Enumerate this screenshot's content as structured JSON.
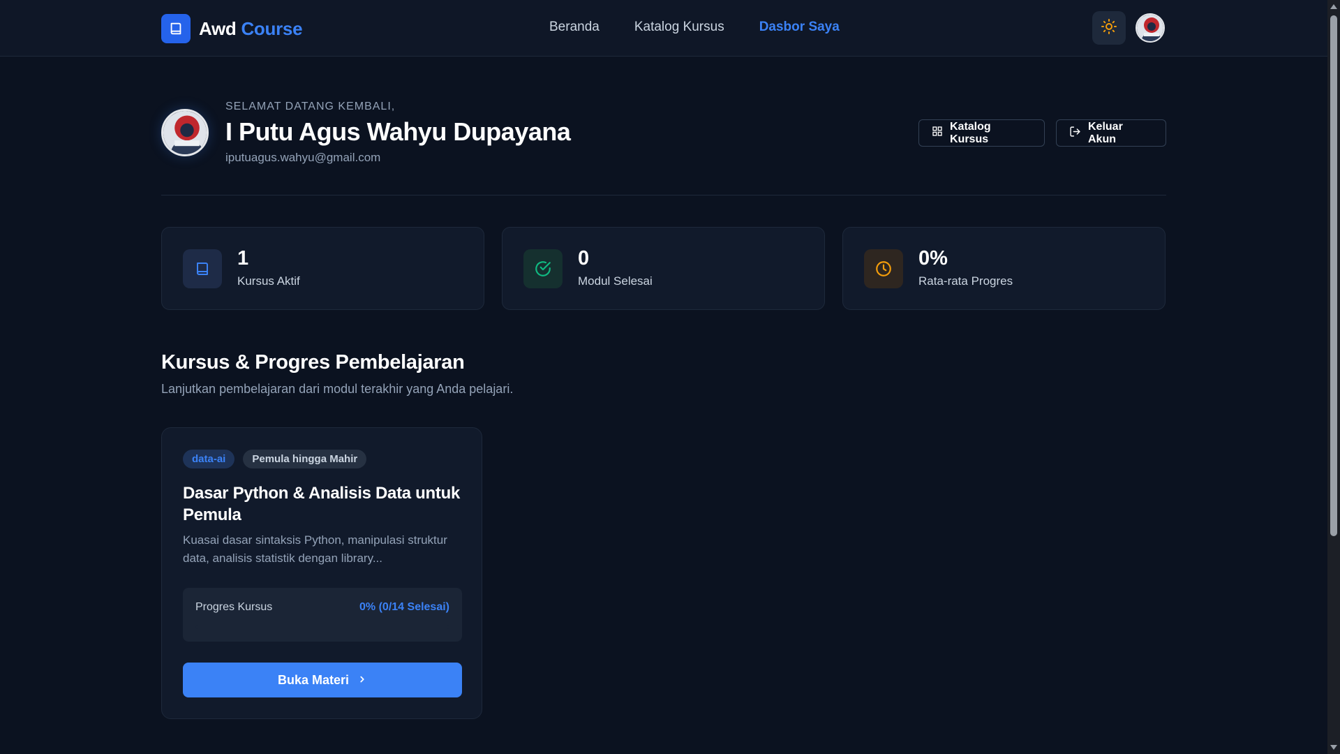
{
  "nav": {
    "brand_a": "Awd",
    "brand_b": "Course",
    "links": [
      {
        "label": "Beranda",
        "active": false
      },
      {
        "label": "Katalog Kursus",
        "active": false
      },
      {
        "label": "Dasbor Saya",
        "active": true
      }
    ],
    "theme_icon": "sun-icon",
    "accent": "#3b82f6"
  },
  "profile": {
    "welcome": "SELAMAT DATANG KEMBALI,",
    "name": "I Putu Agus Wahyu Dupayana",
    "email": "iputuagus.wahyu@gmail.com",
    "catalog_button": "Katalog Kursus",
    "logout_button": "Keluar Akun"
  },
  "stats": [
    {
      "value": "1",
      "label": "Kursus Aktif",
      "icon": "book-icon",
      "color": "#3b82f6"
    },
    {
      "value": "0",
      "label": "Modul Selesai",
      "icon": "check-circle-icon",
      "color": "#10b981"
    },
    {
      "value": "0%",
      "label": "Rata-rata Progres",
      "icon": "clock-icon",
      "color": "#f59e0b"
    }
  ],
  "section": {
    "title": "Kursus & Progres Pembelajaran",
    "subtitle": "Lanjutkan pembelajaran dari modul terakhir yang Anda pelajari."
  },
  "courses": [
    {
      "category": "data-ai",
      "level": "Pemula hingga Mahir",
      "title": "Dasar Python & Analisis Data untuk Pemula",
      "description": "Kuasai dasar sintaksis Python, manipulasi struktur data, analisis statistik dengan library...",
      "progress_label": "Progres Kursus",
      "progress_text": "0% (0/14 Selesai)",
      "progress_percent": 0,
      "button": "Buka Materi"
    }
  ]
}
